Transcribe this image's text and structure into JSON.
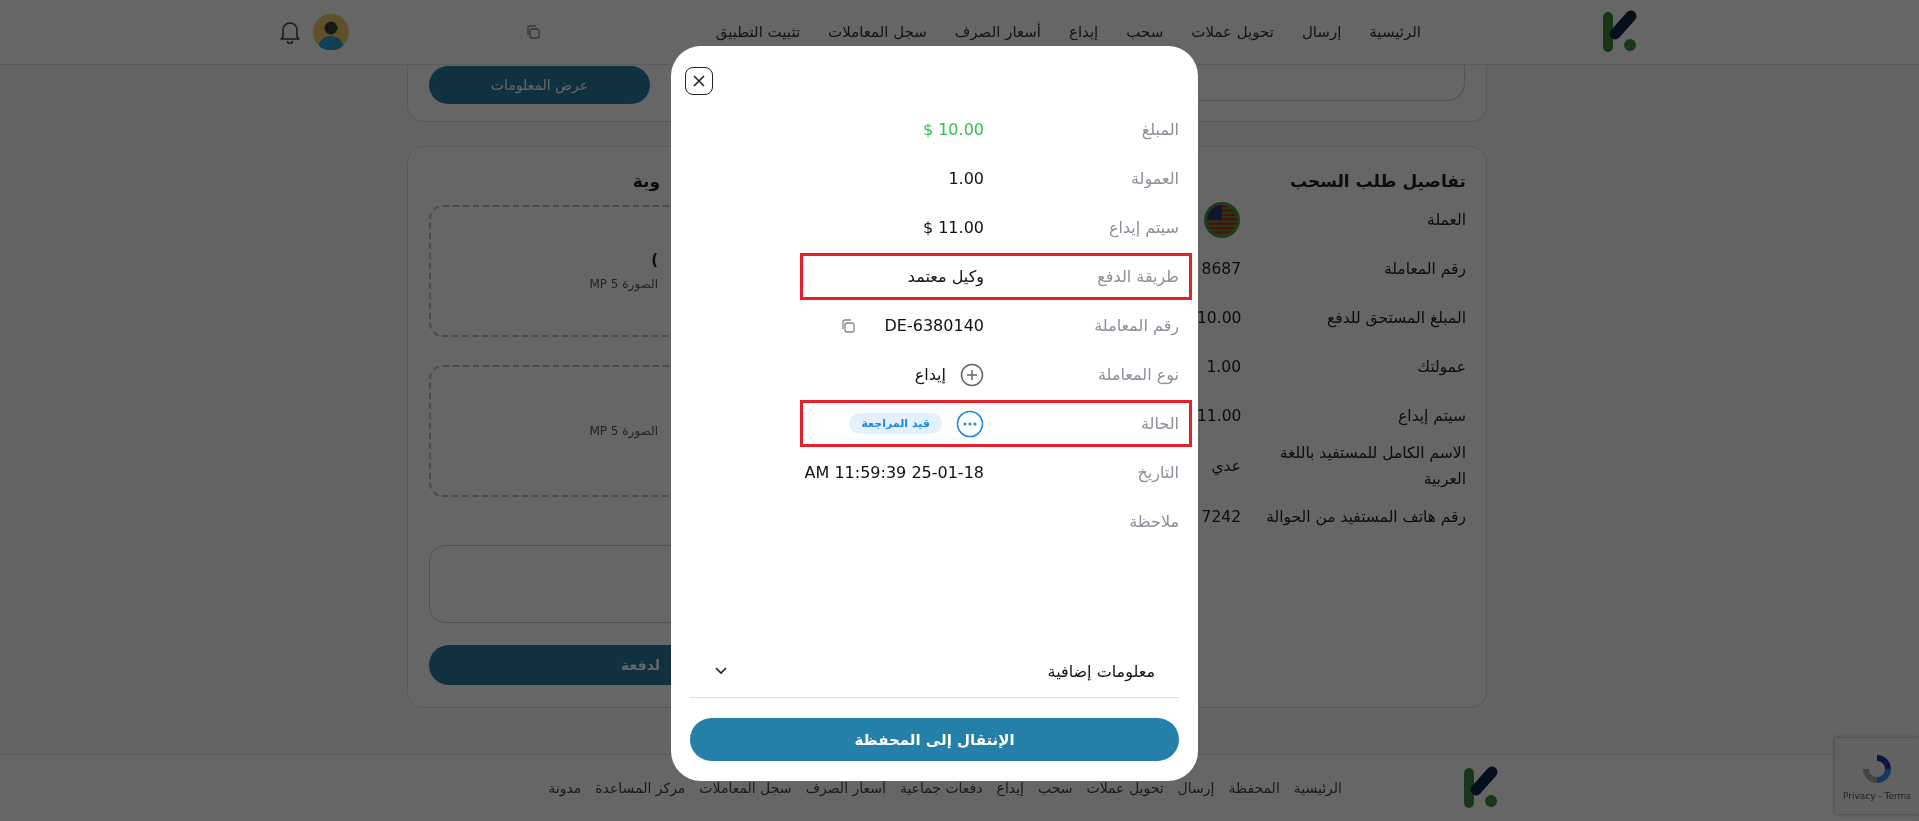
{
  "header": {
    "nav": [
      {
        "label": "الرئيسية"
      },
      {
        "label": "إرسال"
      },
      {
        "label": "تحويل عملات"
      },
      {
        "label": "سحب"
      },
      {
        "label": "إيداع"
      },
      {
        "label": "أسعار الصرف"
      },
      {
        "label": "سجل المعاملات"
      },
      {
        "label": "تثبيت التطبيق"
      }
    ]
  },
  "top_card": {
    "button": "عرض المعلومات"
  },
  "upload_card": {
    "title": "وبة",
    "uploads": [
      {
        "title": ")",
        "hint": "الصورة 5 MP"
      },
      {
        "hint": "الصورة 5 MP"
      }
    ],
    "submit_button": "لدفعة"
  },
  "details": {
    "title": "تفاصيل طلب السحب",
    "rows": [
      {
        "label": "العملة",
        "kind": "flag"
      },
      {
        "label": "رقم المعاملة",
        "value": "8687",
        "kind": "text"
      },
      {
        "label": "المبلغ المستحق للدفع",
        "value": "10.00",
        "kind": "text"
      },
      {
        "label": "عمولتك",
        "value": "1.00",
        "kind": "text"
      },
      {
        "label": "سيتم إيداع",
        "value": "11.00",
        "kind": "text"
      },
      {
        "label": "الاسم الكامل للمستفيد باللغة العربية",
        "value": "عدي",
        "kind": "text"
      },
      {
        "label": "رقم هاتف المستفيد من الحوالة",
        "value": "7242",
        "kind": "text"
      }
    ]
  },
  "modal": {
    "rows": [
      {
        "label": "المبلغ",
        "value": "$ 10.00",
        "kind": "amount",
        "highlighted": false
      },
      {
        "label": "العمولة",
        "value": "1.00",
        "kind": "text",
        "highlighted": false
      },
      {
        "label": "سيتم إيداع",
        "value": "$ 11.00",
        "kind": "text",
        "highlighted": false
      },
      {
        "label": "طريقة الدفع",
        "value": "وكيل معتمد",
        "kind": "text",
        "highlighted": true
      },
      {
        "label": "رقم المعاملة",
        "value": "DE-6380140",
        "kind": "copy",
        "highlighted": false
      },
      {
        "label": "نوع المعاملة",
        "value": "إيداع",
        "kind": "type",
        "highlighted": false
      },
      {
        "label": "الحالة",
        "value": "قيد المراجعة",
        "kind": "status",
        "highlighted": true
      },
      {
        "label": "التاريخ",
        "value": "AM 11:59:39 25-01-18",
        "kind": "text",
        "highlighted": false
      },
      {
        "label": "ملاحظة",
        "kind": "empty",
        "highlighted": false
      }
    ],
    "more_info": {
      "label": "معلومات إضافية",
      "expanded": false
    },
    "button": "الإنتقال إلى المحفظة"
  },
  "footer": {
    "nav": [
      {
        "label": "الرئيسية"
      },
      {
        "label": "المحفظة"
      },
      {
        "label": "إرسال"
      },
      {
        "label": "تحويل عملات"
      },
      {
        "label": "سحب"
      },
      {
        "label": "إيداع"
      },
      {
        "label": "دفعات جماعية"
      },
      {
        "label": "أسعار الصرف"
      },
      {
        "label": "سجل المعاملات"
      },
      {
        "label": "مركز المساعدة"
      },
      {
        "label": "مدونة"
      }
    ]
  },
  "recaptcha": {
    "text": "Privacy - Terms"
  }
}
